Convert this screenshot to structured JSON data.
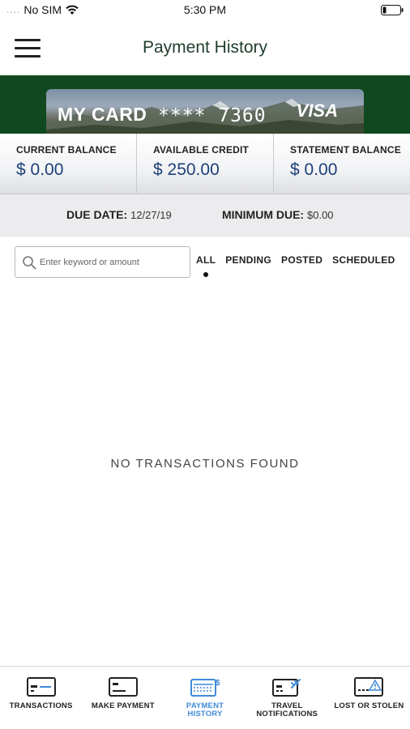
{
  "status_bar": {
    "signal": "....",
    "carrier": "No SIM",
    "time": "5:30 PM"
  },
  "header": {
    "title": "Payment History"
  },
  "card": {
    "name": "MY CARD",
    "number_masked": "**** 7360",
    "network": "VISA"
  },
  "balances": [
    {
      "label": "CURRENT BALANCE",
      "value": "$ 0.00"
    },
    {
      "label": "AVAILABLE CREDIT",
      "value": "$ 250.00"
    },
    {
      "label": "STATEMENT BALANCE",
      "value": "$ 0.00"
    }
  ],
  "due": {
    "date_label": "DUE DATE:",
    "date_value": "12/27/19",
    "min_label": "MINIMUM DUE:",
    "min_value": "$0.00"
  },
  "search": {
    "placeholder": "Enter keyword or amount",
    "value": ""
  },
  "filters": {
    "selected": "ALL",
    "tabs": [
      "ALL",
      "PENDING",
      "POSTED",
      "SCHEDULED"
    ]
  },
  "empty_state": "NO TRANSACTIONS FOUND",
  "bottom_nav": {
    "accent_color": "#3f8ad8",
    "items": [
      {
        "label": "TRANSACTIONS",
        "icon": "card-transactions-icon"
      },
      {
        "label": "MAKE PAYMENT",
        "icon": "card-payment-icon"
      },
      {
        "label_line1": "PAYMENT",
        "label_line2": "HISTORY",
        "icon": "card-history-icon",
        "active": true
      },
      {
        "label_line1": "TRAVEL",
        "label_line2": "NOTIFICATIONS",
        "icon": "card-travel-icon"
      },
      {
        "label": "LOST OR STOLEN",
        "icon": "card-warning-icon"
      }
    ]
  },
  "colors": {
    "header_text": "#1f3d2b",
    "banner_green": "#10491f",
    "balance_blue": "#1d3f7a"
  }
}
